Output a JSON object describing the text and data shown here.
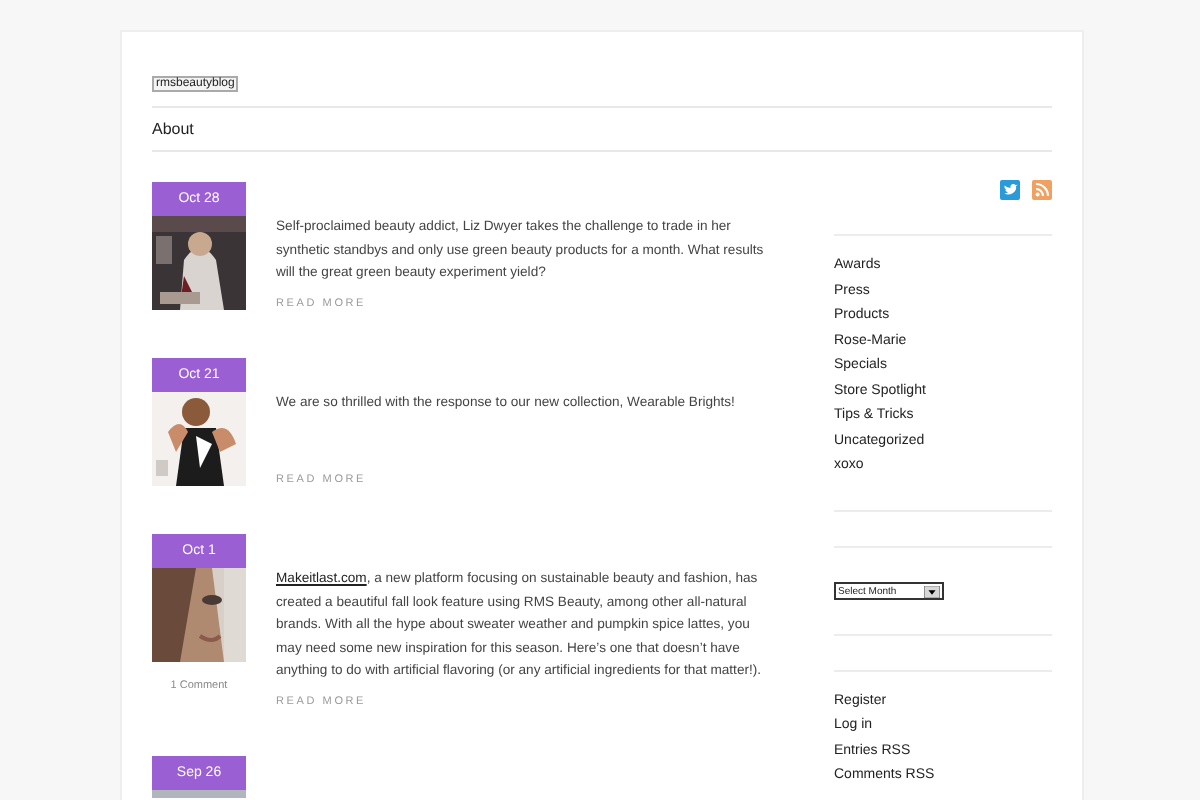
{
  "site": {
    "logo": "rmsbeautyblog"
  },
  "nav": [
    {
      "label": "About"
    }
  ],
  "posts": [
    {
      "date": "Oct 28",
      "text": "Self-proclaimed beauty addict, Liz Dwyer takes the challenge to trade in her synthetic standbys and only use green beauty products for a month. What results will the great green beauty experiment yield?",
      "read_more": "READ MORE"
    },
    {
      "date": "Oct 21",
      "text": "We are so thrilled with the response to our new collection, Wearable Brights!",
      "read_more": "READ MORE"
    },
    {
      "date": "Oct 1",
      "link": "Makeitlast.com",
      "text": ", a new platform focusing on sustainable beauty and fashion, has created a beautiful fall look feature using RMS Beauty, among other all-natural brands. With all the hype about sweater weather and pumpkin spice lattes, you may need some new inspiration for this season. Here’s one that doesn’t have anything to do with artificial flavoring (or any artificial ingredients for that matter!).",
      "comments": "1 Comment",
      "read_more": "READ MORE"
    },
    {
      "date": "Sep 26"
    }
  ],
  "sidebar": {
    "social": [
      {
        "kind": "twitter"
      },
      {
        "kind": "rss"
      }
    ],
    "categories": [
      "Awards",
      "Press",
      "Products",
      "Rose-Marie",
      "Specials",
      "Store Spotlight",
      "Tips & Tricks",
      "Uncategorized",
      "xoxo"
    ],
    "archive_select": "Select Month",
    "meta": [
      "Register",
      "Log in",
      "Entries RSS",
      "Comments RSS"
    ]
  }
}
